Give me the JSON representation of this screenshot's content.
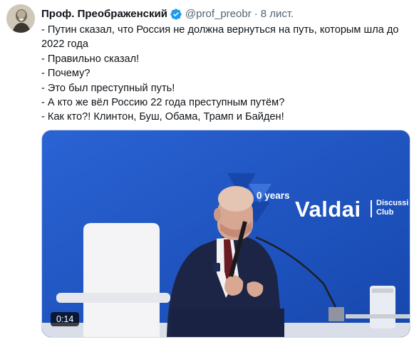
{
  "author": {
    "display_name": "Проф. Преображенский",
    "handle": "@prof_preobr",
    "separator": "·",
    "time": "8 лист.",
    "verified": true,
    "verified_icon": "verified-badge-icon",
    "badge_color": "#1d9bf0"
  },
  "tweet": {
    "lines": [
      "- Путин сказал, что Россия не должна вернуться на путь, которым шла до 2022 года",
      "- Правильно сказал!",
      "- Почему?",
      "- Это был преступный путь!",
      "- А кто же вёл Россию 22 года преступным путём?",
      "- Как кто?! Клинтон, Буш, Обама, Трамп и Байден!"
    ]
  },
  "media": {
    "type": "video",
    "duration": "0:14",
    "backdrop_brand": "Valdai",
    "backdrop_sub_1": "Discussi",
    "backdrop_sub_2": "Club",
    "backdrop_years": "0 years",
    "backdrop_color": "#1f56c4"
  }
}
